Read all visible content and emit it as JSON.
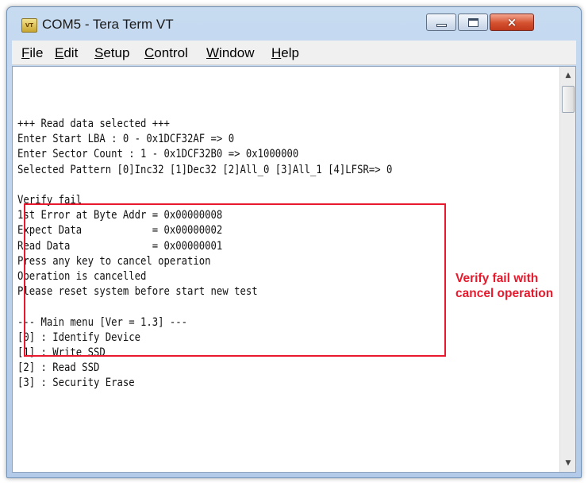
{
  "window": {
    "title": "COM5 - Tera Term VT",
    "icon_text": "VT",
    "controls": {
      "minimize": "minimize-icon",
      "maximize": "maximize-icon",
      "close": "×"
    }
  },
  "menu": [
    "File",
    "Edit",
    "Setup",
    "Control",
    "Window",
    "Help"
  ],
  "terminal": {
    "lines": [
      "+++ Read data selected +++",
      "Enter Start LBA : 0 - 0x1DCF32AF => 0",
      "Enter Sector Count : 1 - 0x1DCF32B0 => 0x1000000",
      "Selected Pattern [0]Inc32 [1]Dec32 [2]All_0 [3]All_1 [4]LFSR=> 0",
      "",
      "Verify fail",
      "1st Error at Byte Addr = 0x00000008",
      "Expect Data            = 0x00000002",
      "Read Data              = 0x00000001",
      "Press any key to cancel operation",
      "Operation is cancelled",
      "Please reset system before start new test",
      "",
      "--- Main menu [Ver = 1.3] ---",
      "[0] : Identify Device",
      "[1] : Write SSD",
      "[2] : Read SSD",
      "[3] : Security Erase"
    ]
  },
  "annotation": {
    "text": "Verify fail with\ncancel operation",
    "color": "#e8192c"
  },
  "scrollbar": {
    "up": "▲",
    "down": "▼"
  }
}
